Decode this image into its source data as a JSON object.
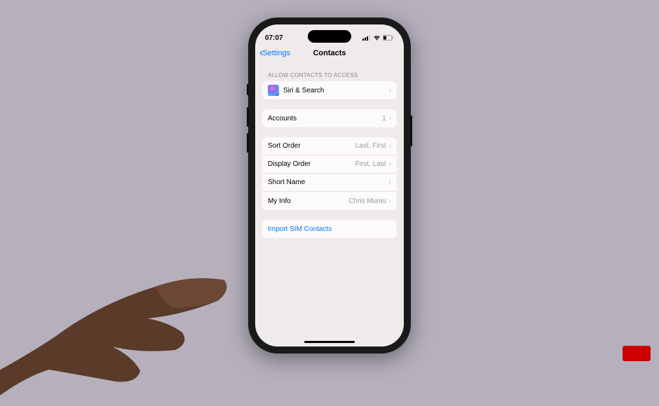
{
  "status_bar": {
    "time": "07:07"
  },
  "nav": {
    "back_label": "Settings",
    "title": "Contacts"
  },
  "sections": {
    "allow_header": "ALLOW CONTACTS TO ACCESS",
    "siri_search": "Siri & Search",
    "accounts": {
      "label": "Accounts",
      "value": "1"
    },
    "sort_order": {
      "label": "Sort Order",
      "value": "Last, First"
    },
    "display_order": {
      "label": "Display Order",
      "value": "First, Last"
    },
    "short_name": {
      "label": "Short Name"
    },
    "my_info": {
      "label": "My Info",
      "value": "Chris Muniu"
    },
    "import_sim": "Import SIM Contacts"
  }
}
